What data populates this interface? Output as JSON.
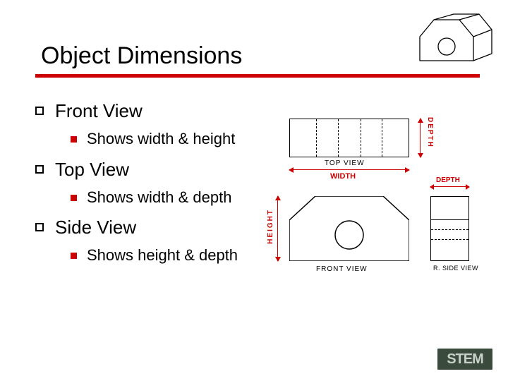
{
  "title": "Object Dimensions",
  "outline": [
    {
      "label": "Front View",
      "sub": "Shows width & height"
    },
    {
      "label": "Top View",
      "sub": "Shows width & depth"
    },
    {
      "label": "Side View",
      "sub": "Shows height & depth"
    }
  ],
  "diagram": {
    "top_label": "TOP VIEW",
    "front_label": "FRONT VIEW",
    "side_label": "R. SIDE VIEW",
    "width": "WIDTH",
    "height": "HEIGHT",
    "depth": "DEPTH"
  },
  "logo": "STEM"
}
